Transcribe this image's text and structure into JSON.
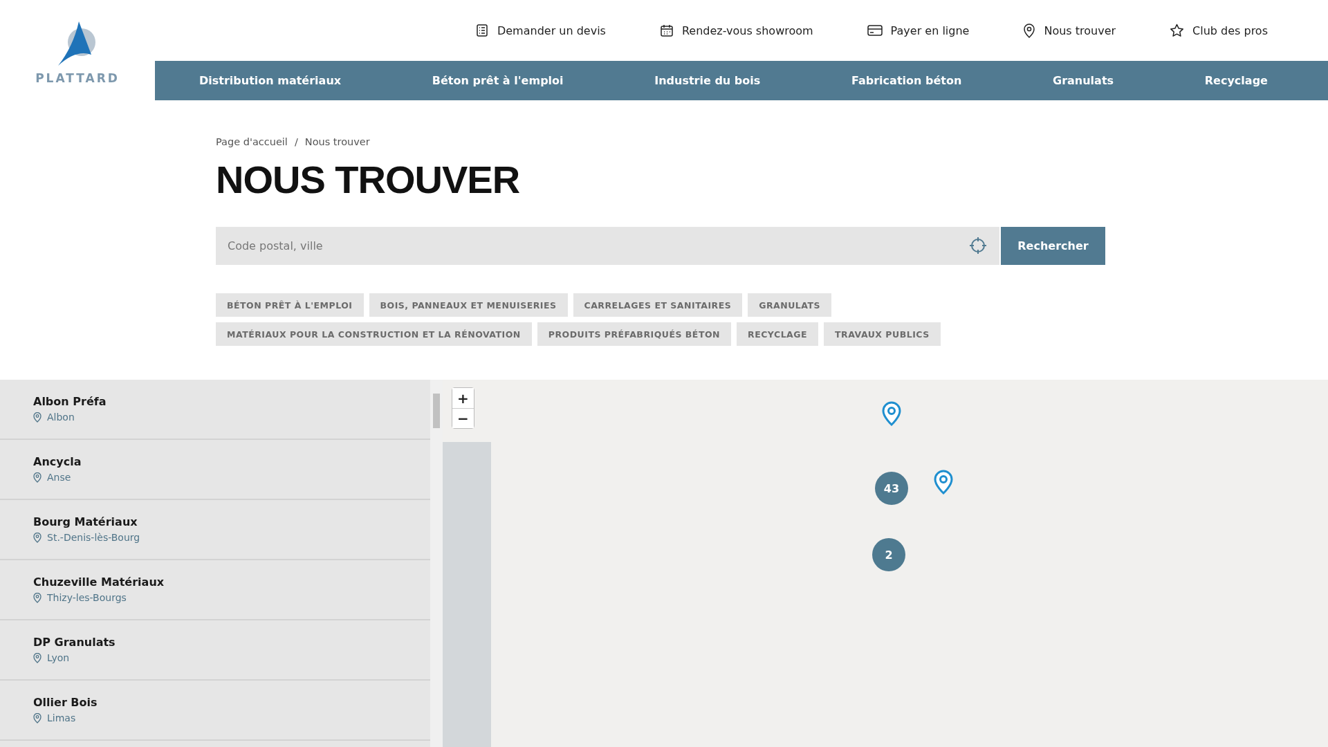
{
  "logo": {
    "name": "PLATTARD"
  },
  "utility_links": [
    {
      "kind": "form",
      "label": "Demander un devis"
    },
    {
      "kind": "calendar",
      "label": "Rendez-vous showroom"
    },
    {
      "kind": "card",
      "label": "Payer en ligne"
    },
    {
      "kind": "pin",
      "label": "Nous trouver"
    },
    {
      "kind": "star",
      "label": "Club des pros"
    }
  ],
  "nav": [
    "Distribution matériaux",
    "Béton prêt à l'emploi",
    "Industrie du bois",
    "Fabrication béton",
    "Granulats",
    "Recyclage"
  ],
  "breadcrumb": {
    "items": [
      "Page d'accueil",
      "Nous trouver"
    ],
    "separator": "/"
  },
  "title": "NOUS TROUVER",
  "search": {
    "placeholder": "Code postal, ville",
    "button": "Rechercher"
  },
  "tags": [
    [
      "BÉTON PRÊT À L'EMPLOI",
      "BOIS, PANNEAUX ET MENUISERIES",
      "CARRELAGES ET SANITAIRES",
      "GRANULATS"
    ],
    [
      "MATÉRIAUX POUR LA CONSTRUCTION ET LA RÉNOVATION",
      "PRODUITS PRÉFABRIQUÉS BÉTON",
      "RECYCLAGE",
      "TRAVAUX PUBLICS"
    ]
  ],
  "stores": [
    {
      "name": "Albon Préfa",
      "city": "Albon"
    },
    {
      "name": "Ancycla",
      "city": "Anse"
    },
    {
      "name": "Bourg Matériaux",
      "city": "St.-Denis-lès-Bourg"
    },
    {
      "name": "Chuzeville Matériaux",
      "city": "Thizy-les-Bourgs"
    },
    {
      "name": "DP Granulats",
      "city": "Lyon"
    },
    {
      "name": "Ollier Bois",
      "city": "Limas"
    }
  ],
  "map": {
    "zoom_in": "+",
    "zoom_out": "−",
    "clusters": [
      "43",
      "2"
    ]
  }
}
